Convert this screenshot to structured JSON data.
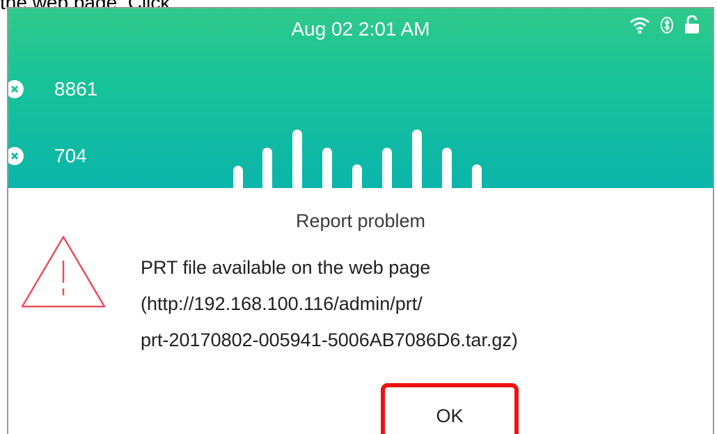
{
  "caption": "the web page. Click",
  "header": {
    "datetime": "Aug 02 2:01 AM",
    "icons": [
      "wifi-icon",
      "bluetooth-icon",
      "unlock-icon"
    ]
  },
  "lines": [
    {
      "number": "8861",
      "icon": "line-x-icon"
    },
    {
      "number": "704",
      "icon": "line-x-icon"
    }
  ],
  "dialog": {
    "title": "Report problem",
    "message_line1": "PRT file available on the web page",
    "message_line2": "(http://192.168.100.116/admin/prt/",
    "message_line3": "prt-20170802-005941-5006AB7086D6.tar.gz)",
    "ok_label": "OK",
    "icon": "warning-icon"
  },
  "colors": {
    "header_start": "#2fc98a",
    "header_end": "#0bb5ab",
    "warning": "#e8505b",
    "highlight": "#ee1111"
  }
}
